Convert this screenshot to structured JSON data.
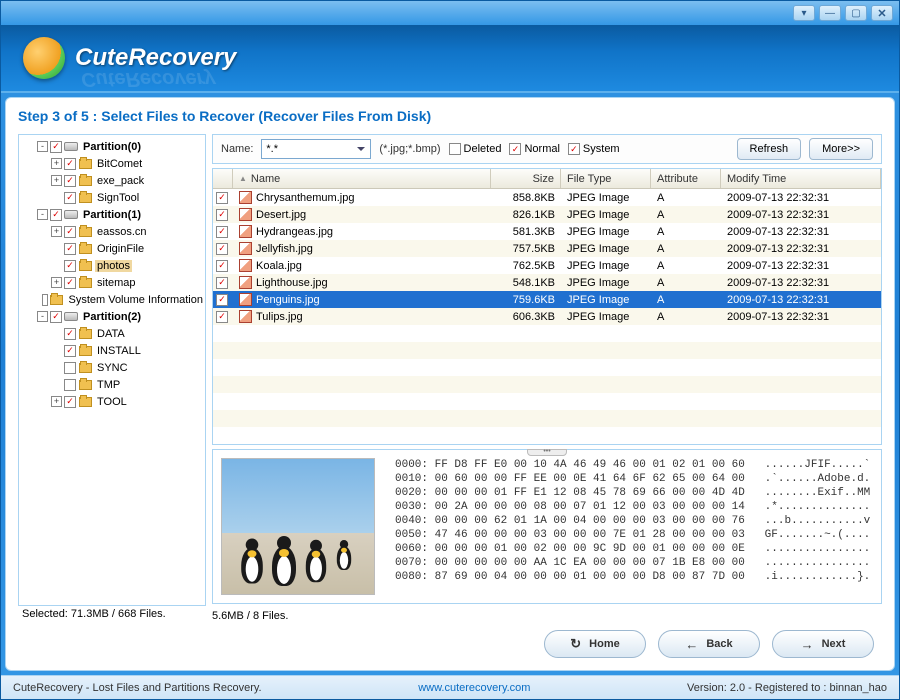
{
  "app": {
    "name": "CuteRecovery"
  },
  "step": {
    "title": "Step 3 of 5 : Select Files to Recover (Recover Files From Disk)"
  },
  "tree": {
    "nodes": [
      {
        "level": 0,
        "expand": "-",
        "checked": true,
        "icon": "disk",
        "label": "Partition(0)",
        "bold": true
      },
      {
        "level": 1,
        "expand": "+",
        "checked": true,
        "icon": "folder",
        "label": "BitComet"
      },
      {
        "level": 1,
        "expand": "+",
        "checked": true,
        "icon": "folder",
        "label": "exe_pack"
      },
      {
        "level": 1,
        "expand": "",
        "checked": true,
        "icon": "folder",
        "label": "SignTool"
      },
      {
        "level": 0,
        "expand": "-",
        "checked": true,
        "icon": "disk",
        "label": "Partition(1)",
        "bold": true
      },
      {
        "level": 1,
        "expand": "+",
        "checked": true,
        "icon": "folder",
        "label": "eassos.cn"
      },
      {
        "level": 1,
        "expand": "",
        "checked": true,
        "icon": "folder",
        "label": "OriginFile"
      },
      {
        "level": 1,
        "expand": "",
        "checked": true,
        "icon": "folder",
        "label": "photos",
        "selected": true
      },
      {
        "level": 1,
        "expand": "+",
        "checked": true,
        "icon": "folder",
        "label": "sitemap"
      },
      {
        "level": 1,
        "expand": "",
        "checked": false,
        "icon": "folder",
        "label": "System Volume Information"
      },
      {
        "level": 0,
        "expand": "-",
        "checked": true,
        "icon": "disk",
        "label": "Partition(2)",
        "bold": true
      },
      {
        "level": 1,
        "expand": "",
        "checked": true,
        "icon": "folder",
        "label": "DATA"
      },
      {
        "level": 1,
        "expand": "",
        "checked": true,
        "icon": "folder",
        "label": "INSTALL"
      },
      {
        "level": 1,
        "expand": "",
        "checked": false,
        "icon": "folder",
        "label": "SYNC"
      },
      {
        "level": 1,
        "expand": "",
        "checked": false,
        "icon": "folder",
        "label": "TMP"
      },
      {
        "level": 1,
        "expand": "+",
        "checked": true,
        "icon": "folder",
        "label": "TOOL"
      }
    ],
    "status": "Selected: 71.3MB / 668 Files."
  },
  "filter": {
    "name_label": "Name:",
    "name_value": "*.*",
    "types": "(*.jpg;*.bmp)",
    "deleted": {
      "label": "Deleted",
      "checked": false
    },
    "normal": {
      "label": "Normal",
      "checked": true
    },
    "system": {
      "label": "System",
      "checked": true
    },
    "refresh": "Refresh",
    "more": "More>>"
  },
  "table": {
    "columns": {
      "name": "Name",
      "size": "Size",
      "type": "File Type",
      "attr": "Attribute",
      "time": "Modify Time"
    },
    "rows": [
      {
        "checked": true,
        "name": "Chrysanthemum.jpg",
        "size": "858.8KB",
        "type": "JPEG Image",
        "attr": "A",
        "time": "2009-07-13 22:32:31"
      },
      {
        "checked": true,
        "name": "Desert.jpg",
        "size": "826.1KB",
        "type": "JPEG Image",
        "attr": "A",
        "time": "2009-07-13 22:32:31"
      },
      {
        "checked": true,
        "name": "Hydrangeas.jpg",
        "size": "581.3KB",
        "type": "JPEG Image",
        "attr": "A",
        "time": "2009-07-13 22:32:31"
      },
      {
        "checked": true,
        "name": "Jellyfish.jpg",
        "size": "757.5KB",
        "type": "JPEG Image",
        "attr": "A",
        "time": "2009-07-13 22:32:31"
      },
      {
        "checked": true,
        "name": "Koala.jpg",
        "size": "762.5KB",
        "type": "JPEG Image",
        "attr": "A",
        "time": "2009-07-13 22:32:31"
      },
      {
        "checked": true,
        "name": "Lighthouse.jpg",
        "size": "548.1KB",
        "type": "JPEG Image",
        "attr": "A",
        "time": "2009-07-13 22:32:31"
      },
      {
        "checked": true,
        "name": "Penguins.jpg",
        "size": "759.6KB",
        "type": "JPEG Image",
        "attr": "A",
        "time": "2009-07-13 22:32:31",
        "selected": true
      },
      {
        "checked": true,
        "name": "Tulips.jpg",
        "size": "606.3KB",
        "type": "JPEG Image",
        "attr": "A",
        "time": "2009-07-13 22:32:31"
      }
    ],
    "status": "5.6MB / 8 Files."
  },
  "hex": "0000: FF D8 FF E0 00 10 4A 46 49 46 00 01 02 01 00 60   ......JFIF.....`\n0010: 00 60 00 00 FF EE 00 0E 41 64 6F 62 65 00 64 00   .`......Adobe.d.\n0020: 00 00 00 01 FF E1 12 08 45 78 69 66 00 00 4D 4D   ........Exif..MM\n0030: 00 2A 00 00 00 08 00 07 01 12 00 03 00 00 00 14   .*..............\n0040: 00 00 00 62 01 1A 00 04 00 00 00 03 00 00 00 76   ...b...........v\n0050: 47 46 00 00 00 03 00 00 00 7E 01 28 00 00 00 03   GF.......~.(....\n0060: 00 00 00 01 00 02 00 00 9C 9D 00 01 00 00 00 0E   ................\n0070: 00 00 00 00 00 AA 1C EA 00 00 00 07 1B E8 00 00   ................\n0080: 87 69 00 04 00 00 00 01 00 00 00 D8 00 87 7D 00   .i............}.",
  "nav": {
    "home": "Home",
    "back": "Back",
    "next": "Next"
  },
  "footer": {
    "left": "CuteRecovery - Lost Files and Partitions Recovery.",
    "link": "www.cuterecovery.com",
    "right": "Version: 2.0 - Registered to : binnan_hao"
  }
}
